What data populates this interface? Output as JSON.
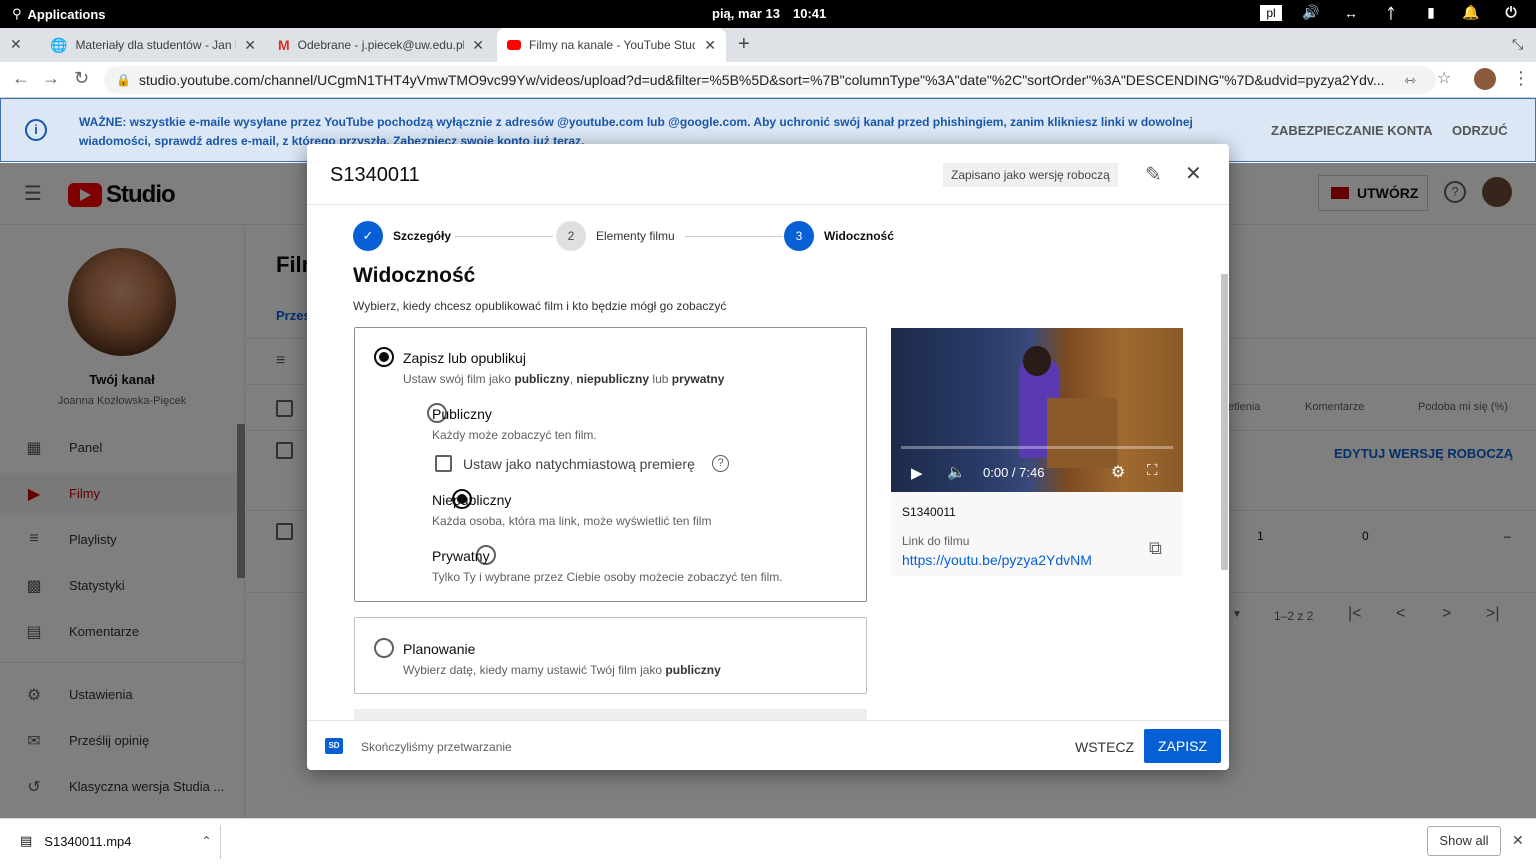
{
  "os": {
    "apps_label": "Applications",
    "date": "pią, mar 13",
    "time": "10:41",
    "lang": "pl"
  },
  "tabs": [
    {
      "title": "Materiały dla studentów - Jan Ko"
    },
    {
      "title": "Odebrane - j.piecek@uw.edu.pl"
    },
    {
      "title": "Filmy na kanale - YouTube Studi"
    }
  ],
  "address": {
    "url": "studio.youtube.com/channel/UCgmN1THT4yVmwTMO9vc99Yw/videos/upload?d=ud&filter=%5B%5D&sort=%7B\"columnType\"%3A\"date\"%2C\"sortOrder\"%3A\"DESCENDING\"%7D&udvid=pyzya2Ydv..."
  },
  "banner": {
    "message": "WAŻNE: wszystkie e-maile wysyłane przez YouTube pochodzą wyłącznie z adresów @youtube.com lub @google.com. Aby uchronić swój kanał przed phishingiem, zanim klikniesz linki w dowolnej wiadomości, sprawdź adres e-mail, z którego przyszła. Zabezpiecz swoje konto już teraz.",
    "secure_btn": "ZABEZPIECZANIE KONTA",
    "dismiss_btn": "ODRZUĆ"
  },
  "studio": {
    "logo": "Studio",
    "create_btn": "UTWÓRZ",
    "page_title": "Filmy",
    "tab": "Przesłane"
  },
  "channel": {
    "label": "Twój kanał",
    "name": "Joanna Kozłowska-Pięcek"
  },
  "sidebar": [
    {
      "label": "Panel"
    },
    {
      "label": "Filmy"
    },
    {
      "label": "Playlisty"
    },
    {
      "label": "Statystyki"
    },
    {
      "label": "Komentarze"
    },
    {
      "label": "Ustawienia"
    },
    {
      "label": "Prześlij opinię"
    },
    {
      "label": "Klasyczna wersja Studia ..."
    }
  ],
  "table": {
    "col_views": "etlenia",
    "col_comments": "Komentarze",
    "col_likes": "Podoba mi się (%)",
    "edit_draft": "EDYTUJ WERSJĘ ROBOCZĄ",
    "row2_views": "1",
    "row2_comments": "0",
    "row2_likes": "–",
    "pagination": "1–2 z 2"
  },
  "modal": {
    "title": "S1340011",
    "saved_chip": "Zapisano jako wersję roboczą",
    "steps": [
      {
        "num": "✓",
        "label": "Szczegóły"
      },
      {
        "num": "2",
        "label": "Elementy filmu"
      },
      {
        "num": "3",
        "label": "Widoczność"
      }
    ],
    "heading": "Widoczność",
    "subtitle": "Wybierz, kiedy chcesz opublikować film i kto będzie mógł go zobaczyć",
    "save_publish": {
      "title": "Zapisz lub opublikuj",
      "desc_pre": "Ustaw swój film jako ",
      "b1": "publiczny",
      "sep1": ", ",
      "b2": "niepubliczny",
      "sep2": " lub ",
      "b3": "prywatny"
    },
    "options": [
      {
        "title": "Publiczny",
        "desc": "Każdy może zobaczyć ten film."
      },
      {
        "title": "Niepubliczny",
        "desc": "Każda osoba, która ma link, może wyświetlić ten film"
      },
      {
        "title": "Prywatny",
        "desc": "Tylko Ty i wybrane przez Ciebie osoby możecie zobaczyć ten film."
      }
    ],
    "premiere": "Ustaw jako natychmiastową premierę",
    "schedule": {
      "title": "Planowanie",
      "desc_pre": "Wybierz datę, kiedy mamy ustawić Twój film jako ",
      "b": "publiczny"
    },
    "video": {
      "time": "0:00 / 7:46",
      "name": "S1340011",
      "link_label": "Link do filmu",
      "link": "https://youtu.be/pyzya2YdvNM"
    },
    "footer": {
      "status": "Skończyliśmy przetwarzanie",
      "back": "WSTECZ",
      "save": "ZAPISZ"
    }
  },
  "download": {
    "file": "S1340011.mp4",
    "show_all": "Show all"
  }
}
